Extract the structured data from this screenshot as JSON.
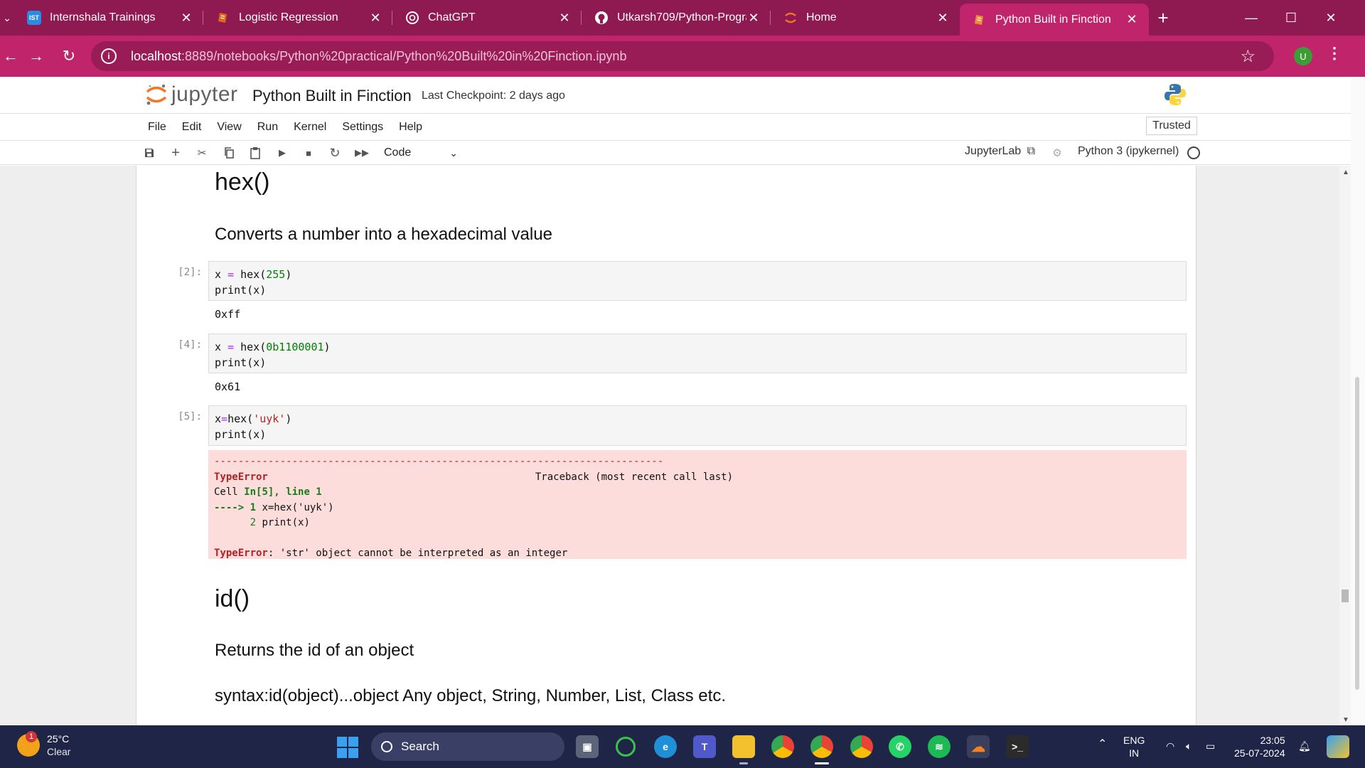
{
  "browser": {
    "tabs": [
      {
        "title": "Internshala Trainings",
        "icon": "internshala-icon",
        "favicon_text": "IST",
        "color": "#2a8be0"
      },
      {
        "title": "Logistic Regression",
        "icon": "jupyter-notebook-icon",
        "favicon_text": "",
        "color": "#e06a14"
      },
      {
        "title": "ChatGPT",
        "icon": "chatgpt-icon",
        "favicon_text": "",
        "color": "#ffffff"
      },
      {
        "title": "Utkarsh709/Python-Progra",
        "icon": "github-icon",
        "favicon_text": "",
        "color": "#ffffff"
      },
      {
        "title": "Home",
        "icon": "jupyter-logo-icon",
        "favicon_text": "",
        "color": "#f37726"
      },
      {
        "title": "Python Built in Finction",
        "icon": "jupyter-notebook-icon",
        "favicon_text": "",
        "color": "#e06a14"
      }
    ],
    "active_tab_index": 5,
    "url_host": "localhost",
    "url_path": ":8889/notebooks/Python%20practical/Python%20Built%20in%20Finction.ipynb",
    "profile_initial": "U",
    "colors": {
      "tabbar": "#8e1a51",
      "active_tab": "#c0246a",
      "omnibox": "#9a1c56"
    }
  },
  "jupyter": {
    "logo_text": "jupyter",
    "notebook_title": "Python Built in Finction",
    "checkpoint": "Last Checkpoint: 2 days ago",
    "menu": [
      "File",
      "Edit",
      "View",
      "Run",
      "Kernel",
      "Settings",
      "Help"
    ],
    "trusted": "Trusted",
    "cell_type": "Code",
    "jupyterlab_link": "JupyterLab",
    "kernel_name": "Python 3 (ipykernel)"
  },
  "notebook": {
    "hex_heading": "hex()",
    "hex_desc": "Converts a number into a hexadecimal value",
    "cells": [
      {
        "prompt": "[2]:",
        "lines": [
          "x = hex(255)",
          "print(x)"
        ],
        "output": "0xff"
      },
      {
        "prompt": "[4]:",
        "lines": [
          "x = hex(0b1100001)",
          "print(x)"
        ],
        "output": "0x61"
      },
      {
        "prompt": "[5]:",
        "lines": [
          "x=hex('uyk')",
          "print(x)"
        ],
        "output": ""
      }
    ],
    "error": {
      "dashes": "---------------------------------------------------------------------------",
      "type": "TypeError",
      "traceback": "Traceback (most recent call last)",
      "cell_prefix": "Cell ",
      "cell_ref": "In[5], line 1",
      "arrow": "----> 1 ",
      "arrow_code": "x=hex('uyk')",
      "line2_num": "      2 ",
      "line2_code": "print(x)",
      "final_type": "TypeError",
      "final_msg": ": 'str' object cannot be interpreted as an integer"
    },
    "id_heading": "id()",
    "id_desc": "Returns the id of an object",
    "id_syntax": "syntax:id(object)...object Any object, String, Number, List, Class etc."
  },
  "taskbar": {
    "temperature": "25°C",
    "condition": "Clear",
    "weather_badge": "1",
    "search_placeholder": "Search",
    "language": "ENG",
    "region": "IN",
    "time": "23:05",
    "date": "25-07-2024"
  }
}
